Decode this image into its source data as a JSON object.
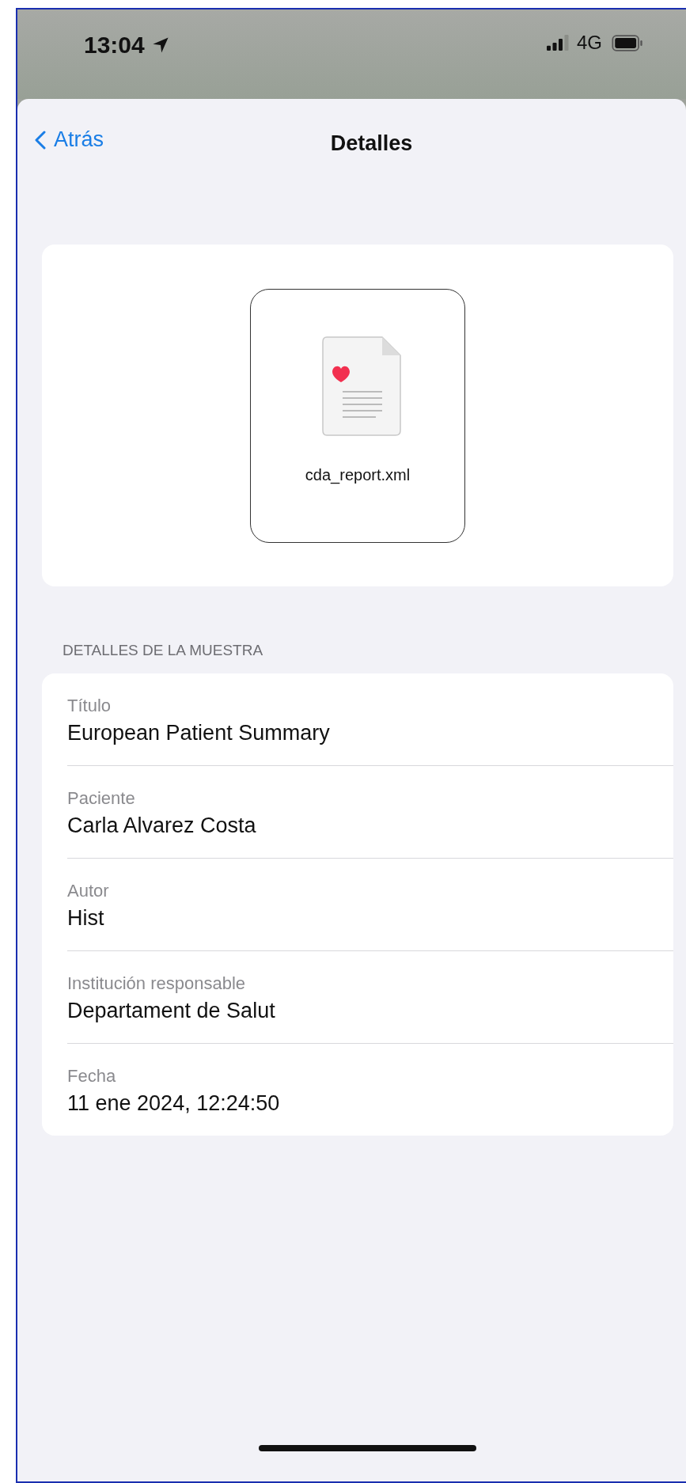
{
  "status_bar": {
    "time": "13:04",
    "network": "4G"
  },
  "nav": {
    "back": "Atrás",
    "title": "Detalles"
  },
  "file": {
    "name": "cda_report.xml"
  },
  "sample_details": {
    "header": "DETALLES DE LA MUESTRA",
    "fields": [
      {
        "label": "Título",
        "value": "European Patient Summary"
      },
      {
        "label": "Paciente",
        "value": "Carla Alvarez Costa"
      },
      {
        "label": "Autor",
        "value": "Hist"
      },
      {
        "label": "Institución responsable",
        "value": "Departament de Salut"
      },
      {
        "label": "Fecha",
        "value": "11 ene 2024, 12:24:50"
      }
    ]
  }
}
